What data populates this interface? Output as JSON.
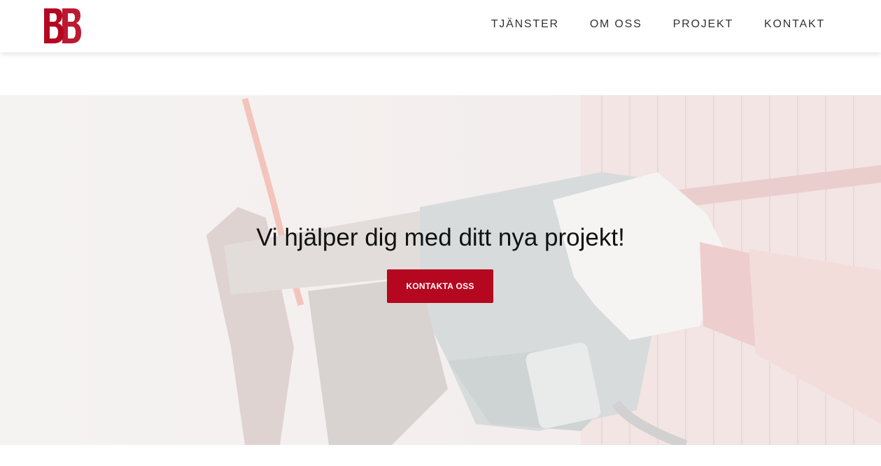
{
  "brand": {
    "accent": "#b5071f"
  },
  "logo": {
    "text": "BB"
  },
  "nav": {
    "items": [
      {
        "label": "TJÄNSTER"
      },
      {
        "label": "OM OSS"
      },
      {
        "label": "PROJEKT"
      },
      {
        "label": "KONTAKT"
      }
    ]
  },
  "hero": {
    "headline": "Vi hjälper dig med ditt nya projekt!",
    "cta_label": "KONTAKTA OSS",
    "background": "power-screwdriver-photo"
  }
}
